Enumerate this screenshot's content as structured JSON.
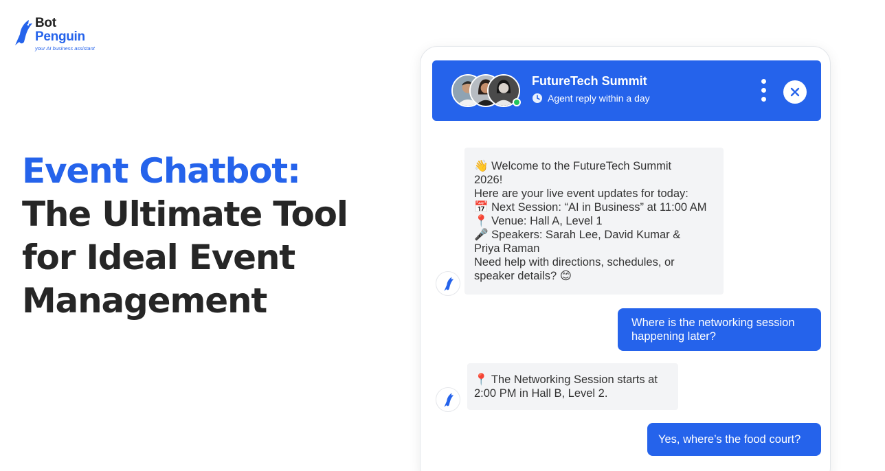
{
  "logo": {
    "line1": "Bot",
    "line2": "Penguin",
    "tagline": "your AI business assistant",
    "icon": "penguin-logo-icon"
  },
  "headline": {
    "line1": "Event Chatbot:",
    "line2": "The Ultimate Tool",
    "line3": "for Ideal Event",
    "line4": "Management"
  },
  "chat": {
    "header": {
      "title": "FutureTech Summit",
      "subtitle": "Agent reply within a day",
      "icons": [
        "agent-avatar",
        "online-status",
        "clock-icon",
        "more-vertical-icon",
        "close-icon"
      ]
    },
    "messages": [
      {
        "sender": "bot",
        "lines": [
          "👋 Welcome to the FutureTech Summit",
          "2026!",
          "Here are your live event updates for today:",
          "📅 Next Session: “AI in Business” at 11:00 AM",
          "📍 Venue: Hall A, Level 1",
          "🎤 Speakers: Sarah Lee, David Kumar &",
          "Priya Raman",
          "Need help with directions, schedules, or",
          "speaker details? 😊"
        ]
      },
      {
        "sender": "user",
        "lines": [
          "Where is the networking session",
          "happening later?"
        ]
      },
      {
        "sender": "bot",
        "lines": [
          "📍 The Networking Session starts at",
          "2:00 PM in Hall B, Level 2."
        ]
      },
      {
        "sender": "user",
        "lines": [
          "Yes, where’s the food court?"
        ]
      }
    ]
  },
  "colors": {
    "brand_blue": "#2563eb",
    "headline_dark": "#262626",
    "bot_bubble": "#f3f4f6",
    "online": "#22c55e"
  }
}
